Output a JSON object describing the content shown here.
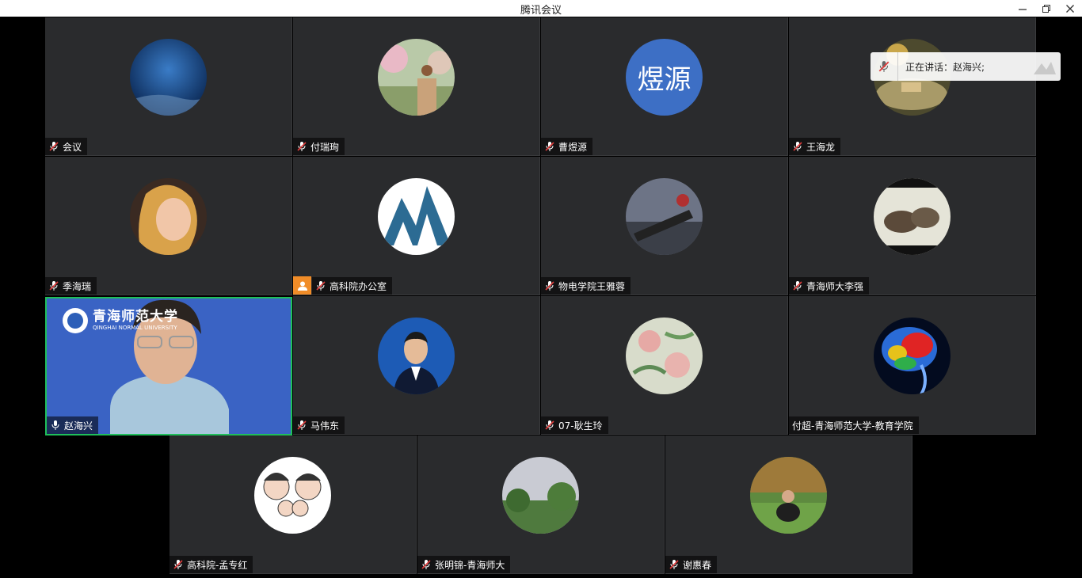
{
  "window": {
    "title": "腾讯会议"
  },
  "speaker": {
    "label": "正在讲话：赵海兴;"
  },
  "participants": [
    {
      "name": "会议"
    },
    {
      "name": "付瑞珣"
    },
    {
      "name": "曹煜源",
      "avatar_text": "煜源"
    },
    {
      "name": "王海龙"
    },
    {
      "name": "季海瑞"
    },
    {
      "name": "高科院办公室"
    },
    {
      "name": "物电学院王雅蓉"
    },
    {
      "name": "青海师大李强"
    },
    {
      "name": "赵海兴",
      "video_banner": "青海师范大学",
      "video_banner_en": "QINGHAI NORMAL UNIVERSITY"
    },
    {
      "name": "马伟东"
    },
    {
      "name": "07-耿生玲"
    },
    {
      "name": "付超-青海师范大学-教育学院"
    },
    {
      "name": "高科院-孟专红"
    },
    {
      "name": "张明锦-青海师大"
    },
    {
      "name": "谢惠春"
    }
  ],
  "colors": {
    "active_speaker_border": "#1fbf5a",
    "host_badge": "#f08c28",
    "tile_bg": "#2a2b2d"
  }
}
